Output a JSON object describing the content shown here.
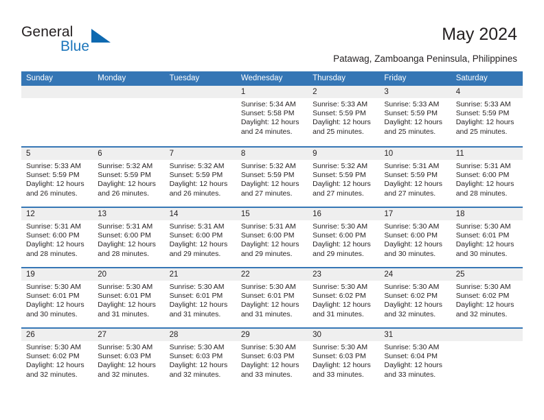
{
  "brand": {
    "name_part1": "General",
    "name_part2": "Blue",
    "triangle_color": "#0e69b0",
    "blue_text_color": "#1b75bb"
  },
  "header": {
    "title": "May 2024",
    "subtitle": "Patawag, Zamboanga Peninsula, Philippines",
    "header_bg_color": "#3576b5",
    "daynum_band_color": "#efefef"
  },
  "weekdays": [
    "Sunday",
    "Monday",
    "Tuesday",
    "Wednesday",
    "Thursday",
    "Friday",
    "Saturday"
  ],
  "weeks": [
    [
      {
        "day": "",
        "empty": true
      },
      {
        "day": "",
        "empty": true
      },
      {
        "day": "",
        "empty": true
      },
      {
        "day": "1",
        "sunrise": "Sunrise: 5:34 AM",
        "sunset": "Sunset: 5:58 PM",
        "daylight_line1": "Daylight: 12 hours",
        "daylight_line2": "and 24 minutes."
      },
      {
        "day": "2",
        "sunrise": "Sunrise: 5:33 AM",
        "sunset": "Sunset: 5:59 PM",
        "daylight_line1": "Daylight: 12 hours",
        "daylight_line2": "and 25 minutes."
      },
      {
        "day": "3",
        "sunrise": "Sunrise: 5:33 AM",
        "sunset": "Sunset: 5:59 PM",
        "daylight_line1": "Daylight: 12 hours",
        "daylight_line2": "and 25 minutes."
      },
      {
        "day": "4",
        "sunrise": "Sunrise: 5:33 AM",
        "sunset": "Sunset: 5:59 PM",
        "daylight_line1": "Daylight: 12 hours",
        "daylight_line2": "and 25 minutes."
      }
    ],
    [
      {
        "day": "5",
        "sunrise": "Sunrise: 5:33 AM",
        "sunset": "Sunset: 5:59 PM",
        "daylight_line1": "Daylight: 12 hours",
        "daylight_line2": "and 26 minutes."
      },
      {
        "day": "6",
        "sunrise": "Sunrise: 5:32 AM",
        "sunset": "Sunset: 5:59 PM",
        "daylight_line1": "Daylight: 12 hours",
        "daylight_line2": "and 26 minutes."
      },
      {
        "day": "7",
        "sunrise": "Sunrise: 5:32 AM",
        "sunset": "Sunset: 5:59 PM",
        "daylight_line1": "Daylight: 12 hours",
        "daylight_line2": "and 26 minutes."
      },
      {
        "day": "8",
        "sunrise": "Sunrise: 5:32 AM",
        "sunset": "Sunset: 5:59 PM",
        "daylight_line1": "Daylight: 12 hours",
        "daylight_line2": "and 27 minutes."
      },
      {
        "day": "9",
        "sunrise": "Sunrise: 5:32 AM",
        "sunset": "Sunset: 5:59 PM",
        "daylight_line1": "Daylight: 12 hours",
        "daylight_line2": "and 27 minutes."
      },
      {
        "day": "10",
        "sunrise": "Sunrise: 5:31 AM",
        "sunset": "Sunset: 5:59 PM",
        "daylight_line1": "Daylight: 12 hours",
        "daylight_line2": "and 27 minutes."
      },
      {
        "day": "11",
        "sunrise": "Sunrise: 5:31 AM",
        "sunset": "Sunset: 6:00 PM",
        "daylight_line1": "Daylight: 12 hours",
        "daylight_line2": "and 28 minutes."
      }
    ],
    [
      {
        "day": "12",
        "sunrise": "Sunrise: 5:31 AM",
        "sunset": "Sunset: 6:00 PM",
        "daylight_line1": "Daylight: 12 hours",
        "daylight_line2": "and 28 minutes."
      },
      {
        "day": "13",
        "sunrise": "Sunrise: 5:31 AM",
        "sunset": "Sunset: 6:00 PM",
        "daylight_line1": "Daylight: 12 hours",
        "daylight_line2": "and 28 minutes."
      },
      {
        "day": "14",
        "sunrise": "Sunrise: 5:31 AM",
        "sunset": "Sunset: 6:00 PM",
        "daylight_line1": "Daylight: 12 hours",
        "daylight_line2": "and 29 minutes."
      },
      {
        "day": "15",
        "sunrise": "Sunrise: 5:31 AM",
        "sunset": "Sunset: 6:00 PM",
        "daylight_line1": "Daylight: 12 hours",
        "daylight_line2": "and 29 minutes."
      },
      {
        "day": "16",
        "sunrise": "Sunrise: 5:30 AM",
        "sunset": "Sunset: 6:00 PM",
        "daylight_line1": "Daylight: 12 hours",
        "daylight_line2": "and 29 minutes."
      },
      {
        "day": "17",
        "sunrise": "Sunrise: 5:30 AM",
        "sunset": "Sunset: 6:00 PM",
        "daylight_line1": "Daylight: 12 hours",
        "daylight_line2": "and 30 minutes."
      },
      {
        "day": "18",
        "sunrise": "Sunrise: 5:30 AM",
        "sunset": "Sunset: 6:01 PM",
        "daylight_line1": "Daylight: 12 hours",
        "daylight_line2": "and 30 minutes."
      }
    ],
    [
      {
        "day": "19",
        "sunrise": "Sunrise: 5:30 AM",
        "sunset": "Sunset: 6:01 PM",
        "daylight_line1": "Daylight: 12 hours",
        "daylight_line2": "and 30 minutes."
      },
      {
        "day": "20",
        "sunrise": "Sunrise: 5:30 AM",
        "sunset": "Sunset: 6:01 PM",
        "daylight_line1": "Daylight: 12 hours",
        "daylight_line2": "and 31 minutes."
      },
      {
        "day": "21",
        "sunrise": "Sunrise: 5:30 AM",
        "sunset": "Sunset: 6:01 PM",
        "daylight_line1": "Daylight: 12 hours",
        "daylight_line2": "and 31 minutes."
      },
      {
        "day": "22",
        "sunrise": "Sunrise: 5:30 AM",
        "sunset": "Sunset: 6:01 PM",
        "daylight_line1": "Daylight: 12 hours",
        "daylight_line2": "and 31 minutes."
      },
      {
        "day": "23",
        "sunrise": "Sunrise: 5:30 AM",
        "sunset": "Sunset: 6:02 PM",
        "daylight_line1": "Daylight: 12 hours",
        "daylight_line2": "and 31 minutes."
      },
      {
        "day": "24",
        "sunrise": "Sunrise: 5:30 AM",
        "sunset": "Sunset: 6:02 PM",
        "daylight_line1": "Daylight: 12 hours",
        "daylight_line2": "and 32 minutes."
      },
      {
        "day": "25",
        "sunrise": "Sunrise: 5:30 AM",
        "sunset": "Sunset: 6:02 PM",
        "daylight_line1": "Daylight: 12 hours",
        "daylight_line2": "and 32 minutes."
      }
    ],
    [
      {
        "day": "26",
        "sunrise": "Sunrise: 5:30 AM",
        "sunset": "Sunset: 6:02 PM",
        "daylight_line1": "Daylight: 12 hours",
        "daylight_line2": "and 32 minutes."
      },
      {
        "day": "27",
        "sunrise": "Sunrise: 5:30 AM",
        "sunset": "Sunset: 6:03 PM",
        "daylight_line1": "Daylight: 12 hours",
        "daylight_line2": "and 32 minutes."
      },
      {
        "day": "28",
        "sunrise": "Sunrise: 5:30 AM",
        "sunset": "Sunset: 6:03 PM",
        "daylight_line1": "Daylight: 12 hours",
        "daylight_line2": "and 32 minutes."
      },
      {
        "day": "29",
        "sunrise": "Sunrise: 5:30 AM",
        "sunset": "Sunset: 6:03 PM",
        "daylight_line1": "Daylight: 12 hours",
        "daylight_line2": "and 33 minutes."
      },
      {
        "day": "30",
        "sunrise": "Sunrise: 5:30 AM",
        "sunset": "Sunset: 6:03 PM",
        "daylight_line1": "Daylight: 12 hours",
        "daylight_line2": "and 33 minutes."
      },
      {
        "day": "31",
        "sunrise": "Sunrise: 5:30 AM",
        "sunset": "Sunset: 6:04 PM",
        "daylight_line1": "Daylight: 12 hours",
        "daylight_line2": "and 33 minutes."
      },
      {
        "day": "",
        "empty": true
      }
    ]
  ]
}
